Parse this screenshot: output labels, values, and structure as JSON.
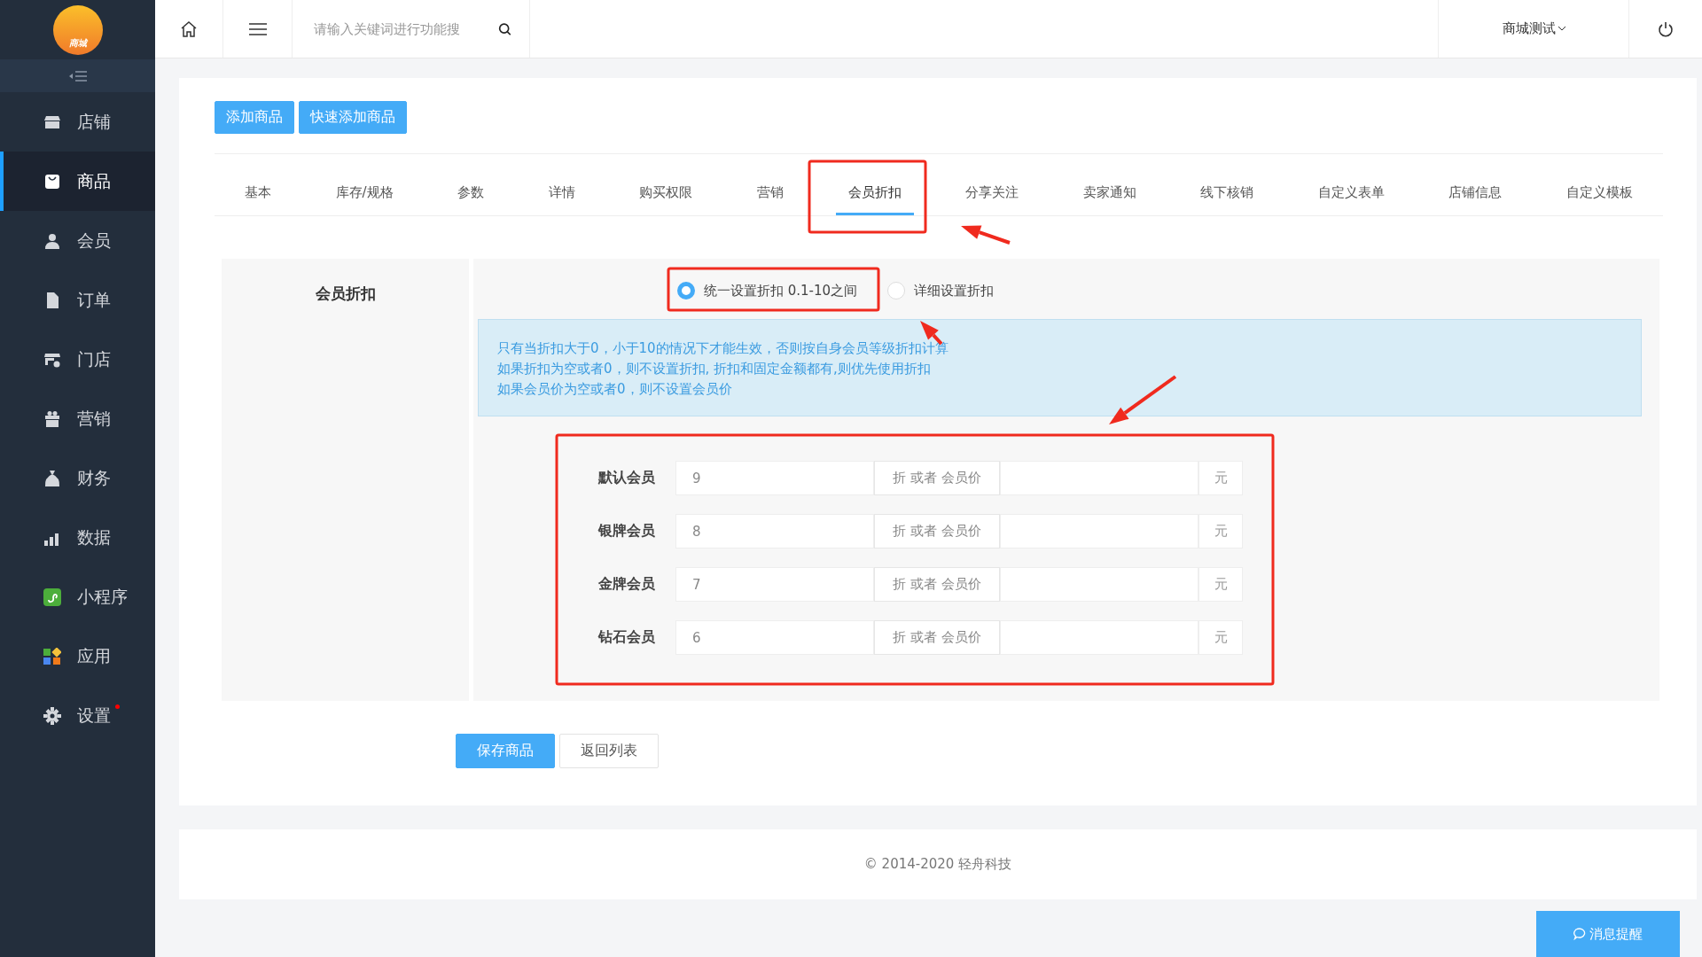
{
  "sidebar": {
    "logo_label": "商城",
    "items": [
      {
        "label": "店铺",
        "selected": false,
        "notification": false
      },
      {
        "label": "商品",
        "selected": true,
        "notification": false
      },
      {
        "label": "会员",
        "selected": false,
        "notification": false
      },
      {
        "label": "订单",
        "selected": false,
        "notification": false
      },
      {
        "label": "门店",
        "selected": false,
        "notification": false
      },
      {
        "label": "营销",
        "selected": false,
        "notification": false
      },
      {
        "label": "财务",
        "selected": false,
        "notification": false
      },
      {
        "label": "数据",
        "selected": false,
        "notification": false
      },
      {
        "label": "小程序",
        "selected": false,
        "notification": false
      },
      {
        "label": "应用",
        "selected": false,
        "notification": false
      },
      {
        "label": "设置",
        "selected": false,
        "notification": true
      }
    ]
  },
  "topbar": {
    "search": {
      "placeholder": "请输入关键词进行功能搜"
    },
    "shop_menu": "商城测试"
  },
  "actions": [
    "添加商品",
    "快速添加商品"
  ],
  "tabs": [
    {
      "label": "基本",
      "selected": false
    },
    {
      "label": "库存/规格",
      "selected": false
    },
    {
      "label": "参数",
      "selected": false
    },
    {
      "label": "详情",
      "selected": false
    },
    {
      "label": "购买权限",
      "selected": false
    },
    {
      "label": "营销",
      "selected": false
    },
    {
      "label": "会员折扣",
      "selected": true
    },
    {
      "label": "分享关注",
      "selected": false
    },
    {
      "label": "卖家通知",
      "selected": false
    },
    {
      "label": "线下核销",
      "selected": false
    },
    {
      "label": "自定义表单",
      "selected": false
    },
    {
      "label": "店铺信息",
      "selected": false
    },
    {
      "label": "自定义模板",
      "selected": false
    }
  ],
  "form": {
    "label": "会员折扣",
    "modes": [
      {
        "label": "统一设置折扣 0.1-10之间",
        "selected": true
      },
      {
        "label": "详细设置折扣",
        "selected": false
      }
    ],
    "notes": [
      "只有当折扣大于0，小于10的情况下才能生效，否则按自身会员等级折扣计算",
      "如果折扣为空或者0，则不设置折扣, 折扣和固定金额都有,则优先使用折扣",
      "如果会员价为空或者0，则不设置会员价"
    ],
    "levels": [
      {
        "name": "默认会员",
        "discount": "9",
        "addon": "折 或者 会员价",
        "unit": "元"
      },
      {
        "name": "银牌会员",
        "discount": "8",
        "addon": "折 或者 会员价",
        "unit": "元"
      },
      {
        "name": "金牌会员",
        "discount": "7",
        "addon": "折 或者 会员价",
        "unit": "元"
      },
      {
        "name": "钻石会员",
        "discount": "6",
        "addon": "折 或者 会员价",
        "unit": "元"
      }
    ]
  },
  "buttons": [
    {
      "label": "保存商品",
      "kind": "primary"
    },
    {
      "label": "返回列表",
      "kind": "default"
    }
  ],
  "footer": "© 2014-2020 轻舟科技",
  "message_button": "消息提醒"
}
